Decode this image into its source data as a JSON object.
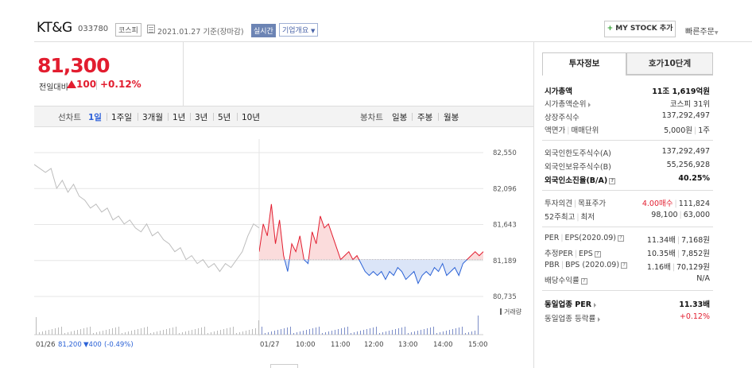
{
  "header": {
    "company": "KT&G",
    "code": "033780",
    "market": "코스피",
    "date_text": "2021.01.27 기준(장마감)",
    "realtime": "실시간",
    "corp_info": "기업개요",
    "mystock_plus": "+",
    "mystock_label": "MY STOCK 추가",
    "quick_order": "빠른주문"
  },
  "price": {
    "current": "81,300",
    "change_label": "전일대비",
    "change_value": "100",
    "change_pct": "+0.12%"
  },
  "period_bar": {
    "line_label": "선차트",
    "periods": [
      "1일",
      "1주일",
      "3개월",
      "1년",
      "3년",
      "5년",
      "10년"
    ],
    "selected": "1일",
    "candle_label": "봉차트",
    "candles": [
      "일봉",
      "주봉",
      "월봉"
    ]
  },
  "chart_data": {
    "type": "line",
    "ylabels": [
      "82,550",
      "82,096",
      "81,643",
      "81,189",
      "80,735"
    ],
    "ylim": [
      80735,
      82550
    ],
    "baseline": 81200,
    "xlabels": [
      "01/27",
      "10:00",
      "11:00",
      "12:00",
      "13:00",
      "14:00",
      "15:00"
    ],
    "volume_label": "거래량",
    "prev_day_label": "01/26",
    "prev_close": "81,200",
    "prev_change": "▼400",
    "prev_change_pct": "(-0.49%)",
    "prev_day_series": [
      82400,
      82350,
      82300,
      82350,
      82100,
      82200,
      82050,
      82150,
      82000,
      81950,
      81850,
      81900,
      81800,
      81850,
      81700,
      81750,
      81650,
      81700,
      81600,
      81550,
      81650,
      81500,
      81550,
      81450,
      81400,
      81300,
      81350,
      81200,
      81250,
      81150,
      81200,
      81100,
      81150,
      81050,
      81150,
      81100,
      81200,
      81300,
      81500,
      81650,
      81600
    ],
    "today_series": [
      81300,
      81650,
      81500,
      81900,
      81400,
      81700,
      81250,
      81050,
      81400,
      81300,
      81500,
      81200,
      81150,
      81550,
      81400,
      81750,
      81600,
      81650,
      81500,
      81350,
      81200,
      81250,
      81300,
      81200,
      81250,
      81150,
      81050,
      81000,
      81050,
      81000,
      81050,
      80950,
      81050,
      81000,
      81100,
      81050,
      80950,
      81000,
      81050,
      80900,
      81000,
      81050,
      81000,
      81100,
      81050,
      81150,
      81000,
      81050,
      81100,
      81000,
      81150,
      81200,
      81250,
      81300,
      81250,
      81300
    ],
    "colors": {
      "up": "#e21d2f",
      "down": "#2b62d6",
      "prev": "#bdbdbd"
    }
  },
  "invest_panel": {
    "tab_active": "투자정보",
    "tab_other": "호가10단계",
    "rows1": [
      {
        "label": "시가총액",
        "value": "11조 1,619억원",
        "bold": true
      },
      {
        "label": "시가총액순위",
        "value": "코스피 31위",
        "caret": true
      },
      {
        "label": "상장주식수",
        "value": "137,292,497"
      },
      {
        "label": "액면가",
        "label2": "매매단위",
        "value": "5,000원",
        "value2": "1주"
      }
    ],
    "rows2": [
      {
        "label": "외국인한도주식수(A)",
        "value": "137,292,497"
      },
      {
        "label": "외국인보유주식수(B)",
        "value": "55,256,928"
      },
      {
        "label": "외국인소진율(B/A)",
        "value": "40.25%",
        "bold": true,
        "help": true
      }
    ],
    "rows3": [
      {
        "label": "투자의견",
        "label2": "목표주가",
        "value_red": "4.00매수",
        "value2": "111,824"
      },
      {
        "label": "52주최고",
        "label2": "최저",
        "value": "98,100",
        "value2": "63,000"
      }
    ],
    "rows4": [
      {
        "label": "PER",
        "label2": "EPS(2020.09)",
        "value": "11.34배",
        "value2": "7,168원"
      },
      {
        "label": "추정PER",
        "label2": "EPS",
        "value": "10.35배",
        "value2": "7,852원"
      },
      {
        "label": "PBR",
        "label2": "BPS (2020.09)",
        "value": "1.16배",
        "value2": "70,129원"
      },
      {
        "label": "배당수익률",
        "value": "N/A"
      }
    ],
    "rows5": [
      {
        "label": "동일업종 PER",
        "value": "11.33배",
        "bold": true
      },
      {
        "label": "동일업종 등락률",
        "value": "+0.12%",
        "red": true
      }
    ],
    "help_glyph": "?"
  }
}
